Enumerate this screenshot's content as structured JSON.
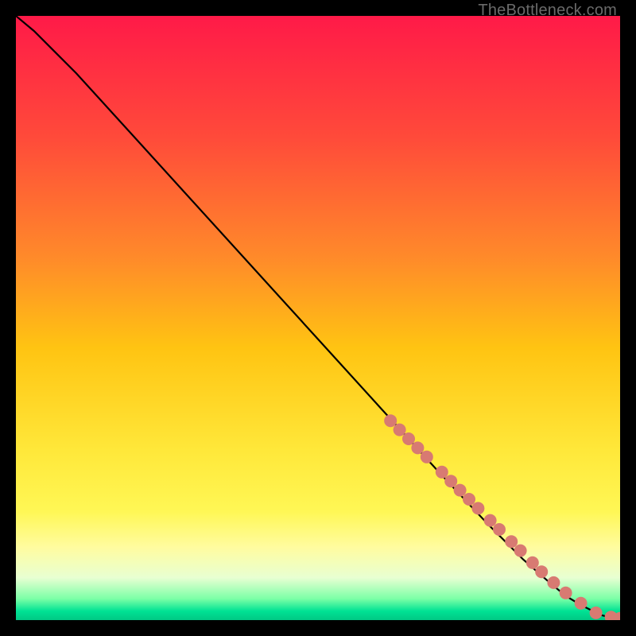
{
  "watermark": "TheBottleneck.com",
  "chart_data": {
    "type": "line",
    "title": "",
    "xlabel": "",
    "ylabel": "",
    "xlim": [
      0,
      100
    ],
    "ylim": [
      0,
      100
    ],
    "grid": false,
    "legend": false,
    "background_gradient": {
      "stops": [
        {
          "offset": 0.0,
          "color": "#ff1a48"
        },
        {
          "offset": 0.2,
          "color": "#ff4a3a"
        },
        {
          "offset": 0.4,
          "color": "#ff8a2a"
        },
        {
          "offset": 0.55,
          "color": "#ffc412"
        },
        {
          "offset": 0.72,
          "color": "#ffe83a"
        },
        {
          "offset": 0.82,
          "color": "#fff755"
        },
        {
          "offset": 0.88,
          "color": "#fffca0"
        },
        {
          "offset": 0.93,
          "color": "#e8ffd2"
        },
        {
          "offset": 0.965,
          "color": "#7affa6"
        },
        {
          "offset": 0.985,
          "color": "#00e294"
        },
        {
          "offset": 1.0,
          "color": "#00c884"
        }
      ]
    },
    "series": [
      {
        "name": "curve",
        "type": "line",
        "color": "#000000",
        "x": [
          0,
          3,
          6,
          10,
          15,
          20,
          30,
          40,
          50,
          60,
          70,
          78,
          84,
          88,
          91,
          93.5,
          95.5,
          97,
          98.5,
          100
        ],
        "y": [
          100,
          97.5,
          94.5,
          90.5,
          85,
          79.5,
          68.5,
          57.5,
          46.5,
          35.5,
          24.5,
          16,
          10,
          6.5,
          4,
          2.5,
          1.5,
          0.8,
          0.4,
          0.2
        ]
      },
      {
        "name": "points",
        "type": "scatter",
        "color": "#d87a72",
        "radius": 8,
        "x": [
          62,
          63.5,
          65,
          66.5,
          68,
          70.5,
          72,
          73.5,
          75,
          76.5,
          78.5,
          80,
          82,
          83.5,
          85.5,
          87,
          89,
          91,
          93.5,
          96,
          98.5,
          100
        ],
        "y": [
          33,
          31.5,
          30,
          28.5,
          27,
          24.5,
          23,
          21.5,
          20,
          18.5,
          16.5,
          15,
          13,
          11.5,
          9.5,
          8,
          6.2,
          4.5,
          2.8,
          1.2,
          0.5,
          0.3
        ]
      }
    ]
  }
}
